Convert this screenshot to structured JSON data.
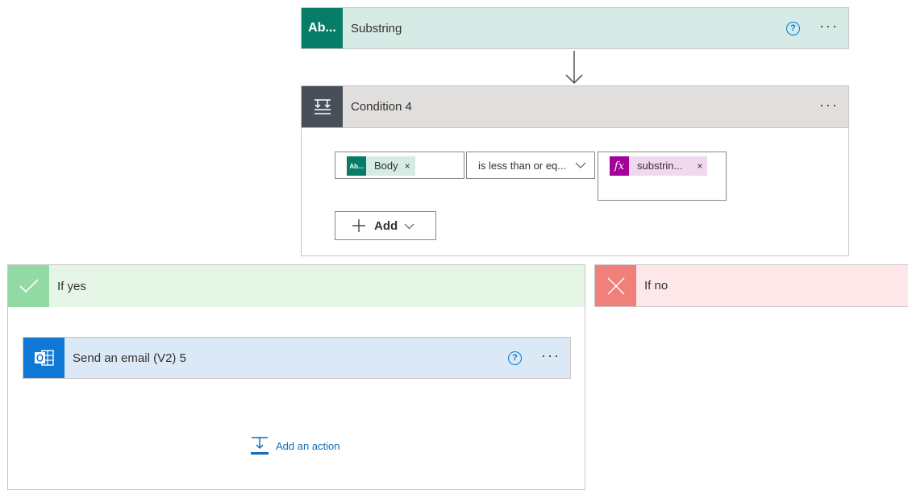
{
  "substring": {
    "icon_text": "Ab...",
    "title": "Substring",
    "help": "?",
    "more": "···"
  },
  "condition": {
    "title": "Condition 4",
    "more": "···",
    "left_token": {
      "icon_text": "Ab...",
      "label": "Body",
      "remove": "×"
    },
    "operator": "is less than or eq...",
    "right_token": {
      "icon_text": "fx",
      "label": "substrin...",
      "remove": "×"
    },
    "add_label": "Add"
  },
  "branch_yes": {
    "title": "If yes",
    "action": {
      "title": "Send an email (V2) 5",
      "help": "?",
      "more": "···"
    },
    "add_action": "Add an action"
  },
  "branch_no": {
    "title": "If no"
  },
  "colors": {
    "substring_accent": "#077d68",
    "condition_accent": "#484f58",
    "yes_accent": "#92d9a4",
    "no_accent": "#f1807b",
    "outlook_accent": "#0f78d4",
    "fx_accent": "#a4009a",
    "link_blue": "#0f6cbd"
  }
}
